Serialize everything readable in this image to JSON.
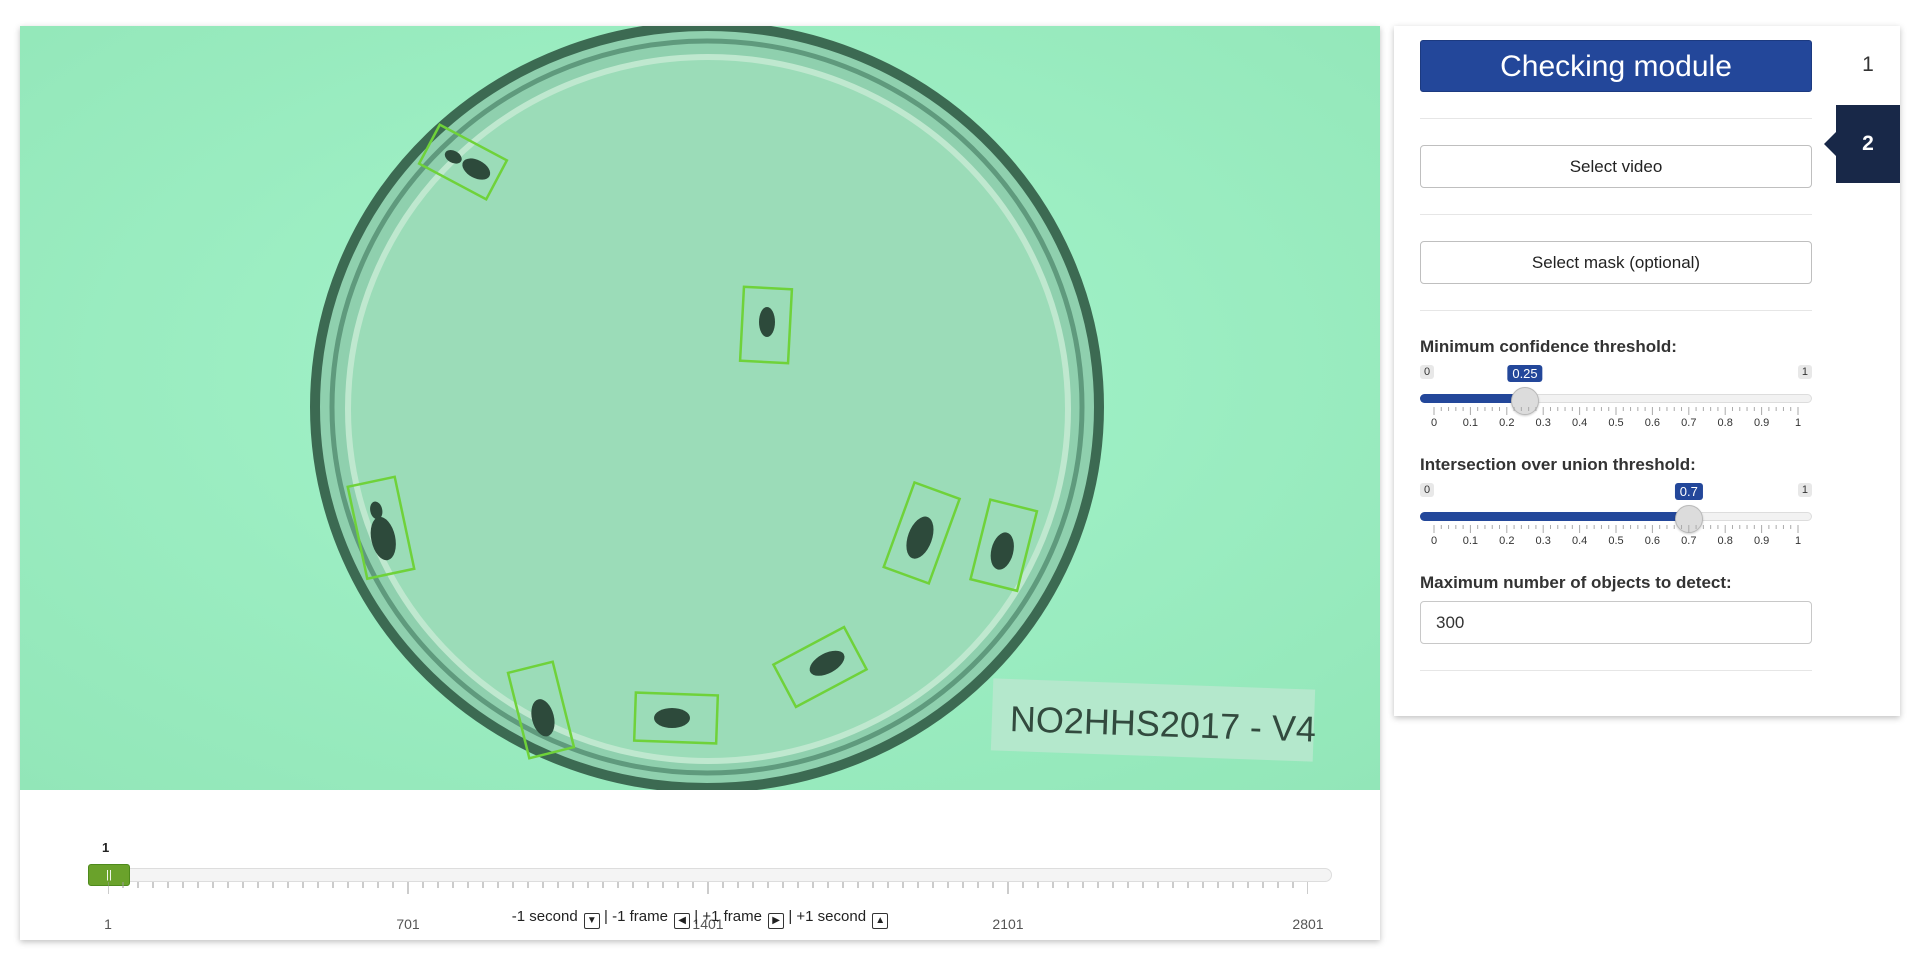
{
  "video": {
    "label_text": "NO2HHS2017 - V4"
  },
  "frame_slider": {
    "current": 1,
    "min": 1,
    "max": 2801,
    "handle_glyph": "||",
    "tick_labels": [
      "1",
      "701",
      "1401",
      "2101",
      "2801"
    ]
  },
  "frame_nav": {
    "minus_second": "-1 second",
    "minus_frame": "-1 frame",
    "plus_frame": "+1 frame",
    "plus_second": "+1 second",
    "separator": "|"
  },
  "panel": {
    "title": "Checking module",
    "select_video": "Select video",
    "select_mask": "Select mask (optional)",
    "confidence": {
      "label": "Minimum confidence threshold:",
      "min": "0",
      "max": "1",
      "value": 0.25,
      "value_label": "0.25",
      "grid": [
        "0",
        "0.1",
        "0.2",
        "0.3",
        "0.4",
        "0.5",
        "0.6",
        "0.7",
        "0.8",
        "0.9",
        "1"
      ]
    },
    "iou": {
      "label": "Intersection over union threshold:",
      "min": "0",
      "max": "1",
      "value": 0.7,
      "value_label": "0.7",
      "grid": [
        "0",
        "0.1",
        "0.2",
        "0.3",
        "0.4",
        "0.5",
        "0.6",
        "0.7",
        "0.8",
        "0.9",
        "1"
      ]
    },
    "max_objects": {
      "label": "Maximum number of objects to detect:",
      "value": "300"
    }
  },
  "tabs": [
    {
      "label": "1",
      "active": false
    },
    {
      "label": "2",
      "active": true
    }
  ],
  "colors": {
    "accent": "#23479a",
    "tab_active": "#182848",
    "frame_handle": "#6aa22b",
    "detection_box": "#6fd23a",
    "background_tint": "#9ff0c4"
  },
  "icons": {
    "down": "arrow-down-icon",
    "left": "arrow-left-icon",
    "right": "arrow-right-icon",
    "up": "arrow-up-icon"
  }
}
